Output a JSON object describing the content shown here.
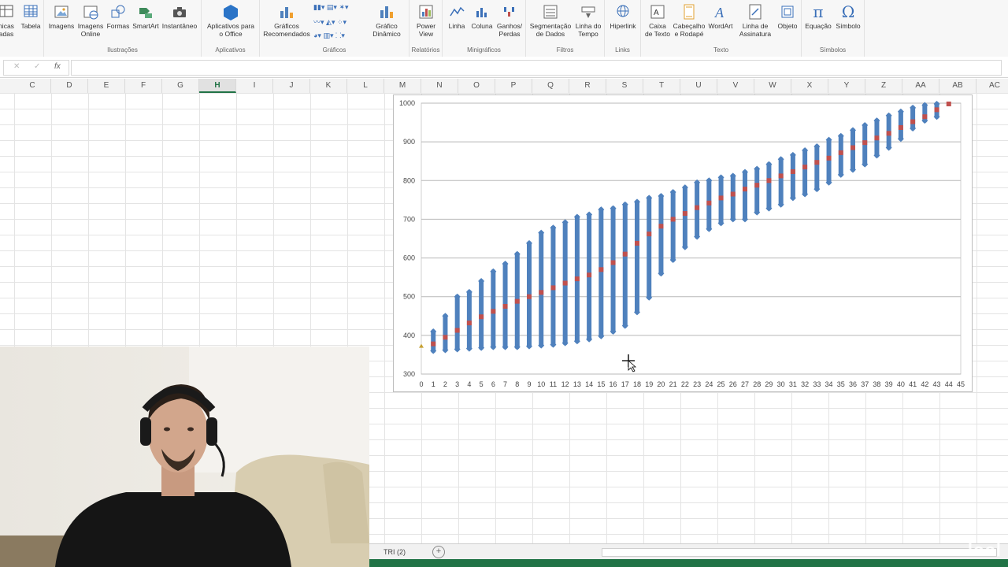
{
  "ribbon": {
    "groups": [
      {
        "label": "",
        "buttons": [
          "nicas\nadas",
          "Tabela"
        ]
      },
      {
        "label": "Ilustrações",
        "buttons": [
          "Imagens",
          "Imagens\nOnline",
          "Formas",
          "SmartArt",
          "Instantâneo"
        ]
      },
      {
        "label": "Aplicativos",
        "buttons": [
          "Aplicativos para\no Office"
        ]
      },
      {
        "label": "Gráficos",
        "buttons": [
          "Gráficos\nRecomendados",
          "Gráfico\nDinâmico"
        ]
      },
      {
        "label": "Relatórios",
        "buttons": [
          "Power\nView"
        ]
      },
      {
        "label": "Minigráficos",
        "buttons": [
          "Linha",
          "Coluna",
          "Ganhos/\nPerdas"
        ]
      },
      {
        "label": "Filtros",
        "buttons": [
          "Segmentação\nde Dados",
          "Linha do\nTempo"
        ]
      },
      {
        "label": "Links",
        "buttons": [
          "Hiperlink"
        ]
      },
      {
        "label": "Texto",
        "buttons": [
          "Caixa\nde Texto",
          "Cabeçalho\ne Rodapé",
          "WordArt",
          "Linha de\nAssinatura",
          "Objeto"
        ]
      },
      {
        "label": "Símbolos",
        "buttons": [
          "Equação",
          "Símbolo"
        ]
      }
    ]
  },
  "formula_bar": {
    "cancel": "✕",
    "enter": "✓",
    "fx": "fx",
    "value": ""
  },
  "columns": [
    "C",
    "D",
    "E",
    "F",
    "G",
    "H",
    "I",
    "J",
    "K",
    "L",
    "M",
    "N",
    "O",
    "P",
    "Q",
    "R",
    "S",
    "T",
    "U",
    "V",
    "W",
    "X",
    "Y",
    "Z",
    "AA",
    "AB",
    "AC"
  ],
  "selected_column": "H",
  "sheet": {
    "tab": "TRI (2)",
    "add": "+"
  },
  "watermark": "lool",
  "colors": {
    "series_blue": "#4f81bd",
    "series_red": "#c0504d",
    "excel_green": "#217346"
  },
  "chart_data": {
    "type": "scatter",
    "title": "",
    "xlabel": "",
    "ylabel": "",
    "xlim": [
      0,
      45
    ],
    "ylim": [
      300,
      1000
    ],
    "x_ticks": [
      0,
      1,
      2,
      3,
      4,
      5,
      6,
      7,
      8,
      9,
      10,
      11,
      12,
      13,
      14,
      15,
      16,
      17,
      18,
      19,
      20,
      21,
      22,
      23,
      24,
      25,
      26,
      27,
      28,
      29,
      30,
      31,
      32,
      33,
      34,
      35,
      36,
      37,
      38,
      39,
      40,
      41,
      42,
      43,
      44,
      45
    ],
    "y_ticks": [
      300,
      400,
      500,
      600,
      700,
      800,
      900,
      1000
    ],
    "grid": "horizontal",
    "legend": "none",
    "series": [
      {
        "marker": "diamond",
        "color": "#4f81bd",
        "ranges": [
          {
            "x": 1,
            "min": 360,
            "max": 410
          },
          {
            "x": 2,
            "min": 362,
            "max": 450
          },
          {
            "x": 3,
            "min": 364,
            "max": 500
          },
          {
            "x": 4,
            "min": 366,
            "max": 512
          },
          {
            "x": 5,
            "min": 368,
            "max": 540
          },
          {
            "x": 6,
            "min": 370,
            "max": 565
          },
          {
            "x": 7,
            "min": 370,
            "max": 585
          },
          {
            "x": 8,
            "min": 370,
            "max": 610
          },
          {
            "x": 9,
            "min": 372,
            "max": 638
          },
          {
            "x": 10,
            "min": 374,
            "max": 665
          },
          {
            "x": 11,
            "min": 376,
            "max": 678
          },
          {
            "x": 12,
            "min": 380,
            "max": 692
          },
          {
            "x": 13,
            "min": 385,
            "max": 706
          },
          {
            "x": 14,
            "min": 390,
            "max": 712
          },
          {
            "x": 15,
            "min": 398,
            "max": 725
          },
          {
            "x": 16,
            "min": 410,
            "max": 728
          },
          {
            "x": 17,
            "min": 425,
            "max": 738
          },
          {
            "x": 18,
            "min": 460,
            "max": 745
          },
          {
            "x": 19,
            "min": 498,
            "max": 755
          },
          {
            "x": 20,
            "min": 560,
            "max": 760
          },
          {
            "x": 21,
            "min": 595,
            "max": 770
          },
          {
            "x": 22,
            "min": 628,
            "max": 782
          },
          {
            "x": 23,
            "min": 655,
            "max": 795
          },
          {
            "x": 24,
            "min": 675,
            "max": 800
          },
          {
            "x": 25,
            "min": 690,
            "max": 808
          },
          {
            "x": 26,
            "min": 700,
            "max": 812
          },
          {
            "x": 27,
            "min": 700,
            "max": 822
          },
          {
            "x": 28,
            "min": 718,
            "max": 830
          },
          {
            "x": 29,
            "min": 728,
            "max": 842
          },
          {
            "x": 30,
            "min": 738,
            "max": 855
          },
          {
            "x": 31,
            "min": 755,
            "max": 866
          },
          {
            "x": 32,
            "min": 765,
            "max": 878
          },
          {
            "x": 33,
            "min": 778,
            "max": 888
          },
          {
            "x": 34,
            "min": 795,
            "max": 905
          },
          {
            "x": 35,
            "min": 815,
            "max": 915
          },
          {
            "x": 36,
            "min": 828,
            "max": 930
          },
          {
            "x": 37,
            "min": 842,
            "max": 943
          },
          {
            "x": 38,
            "min": 865,
            "max": 955
          },
          {
            "x": 39,
            "min": 885,
            "max": 968
          },
          {
            "x": 40,
            "min": 908,
            "max": 978
          },
          {
            "x": 41,
            "min": 935,
            "max": 988
          },
          {
            "x": 42,
            "min": 955,
            "max": 995
          },
          {
            "x": 43,
            "min": 965,
            "max": 998
          }
        ]
      },
      {
        "marker": "square",
        "color": "#c0504d",
        "x": [
          1,
          2,
          3,
          4,
          5,
          6,
          7,
          8,
          9,
          10,
          11,
          12,
          13,
          14,
          15,
          16,
          17,
          18,
          19,
          20,
          21,
          22,
          23,
          24,
          25,
          26,
          27,
          28,
          29,
          30,
          31,
          32,
          33,
          34,
          35,
          36,
          37,
          38,
          39,
          40,
          41,
          42,
          43,
          44
        ],
        "y": [
          378,
          395,
          413,
          432,
          448,
          462,
          475,
          488,
          500,
          511,
          523,
          535,
          546,
          556,
          570,
          588,
          610,
          638,
          662,
          682,
          700,
          715,
          730,
          742,
          755,
          765,
          778,
          788,
          800,
          812,
          823,
          835,
          847,
          858,
          872,
          885,
          898,
          910,
          922,
          937,
          952,
          965,
          983,
          998
        ]
      }
    ]
  }
}
